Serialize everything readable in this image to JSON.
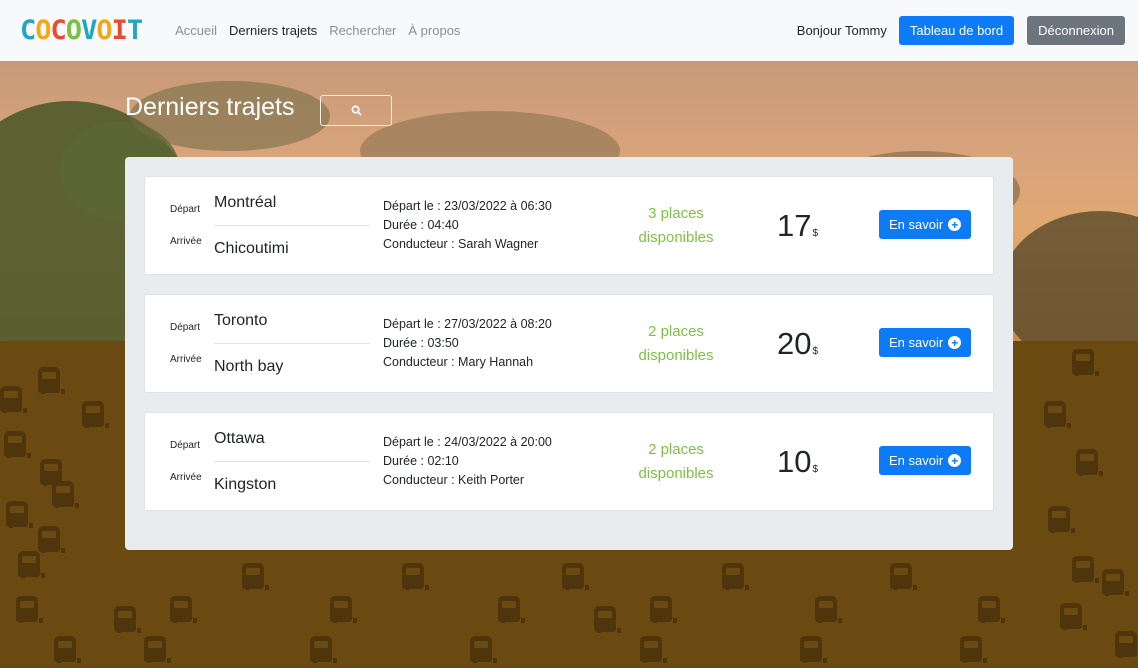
{
  "brand": {
    "logo_letters": [
      "C",
      "O",
      "C",
      "O",
      "V",
      "O",
      "I",
      "T"
    ],
    "logo_colors": [
      "#23a5c6",
      "#f0a81d",
      "#e84b2f",
      "#7cc242",
      "#23a5c6",
      "#f0a81d",
      "#e84b2f",
      "#23a5c6"
    ]
  },
  "nav": {
    "links": [
      {
        "label": "Accueil"
      },
      {
        "label": "Derniers trajets",
        "active": true
      },
      {
        "label": "Rechercher"
      },
      {
        "label": "À propos"
      }
    ],
    "greeting": "Bonjour Tommy",
    "dashboard_label": "Tableau de bord",
    "logout_label": "Déconnexion"
  },
  "page": {
    "title": "Derniers trajets",
    "search_icon": "search-icon"
  },
  "labels": {
    "departure": "Départ",
    "arrival": "Arrivée",
    "more": "En savoir",
    "currency": "$"
  },
  "trips": [
    {
      "from": "Montréal",
      "to": "Chicoutimi",
      "depart": "Départ le : 23/03/2022 à 06:30",
      "duration": "Durée : 04:40",
      "driver": "Conducteur : Sarah Wagner",
      "seats_line1": "3 places",
      "seats_line2": "disponibles",
      "price": "17"
    },
    {
      "from": "Toronto",
      "to": "North bay",
      "depart": "Départ le : 27/03/2022 à 08:20",
      "duration": "Durée : 03:50",
      "driver": "Conducteur : Mary Hannah",
      "seats_line1": "2 places",
      "seats_line2": "disponibles",
      "price": "20"
    },
    {
      "from": "Ottawa",
      "to": "Kingston",
      "depart": "Départ le : 24/03/2022 à 20:00",
      "duration": "Durée : 02:10",
      "driver": "Conducteur : Keith Porter",
      "seats_line1": "2 places",
      "seats_line2": "disponibles",
      "price": "10"
    }
  ],
  "colors": {
    "primary": "#0d7bf5",
    "secondary": "#6c757d",
    "seats_green": "#7cc242"
  }
}
